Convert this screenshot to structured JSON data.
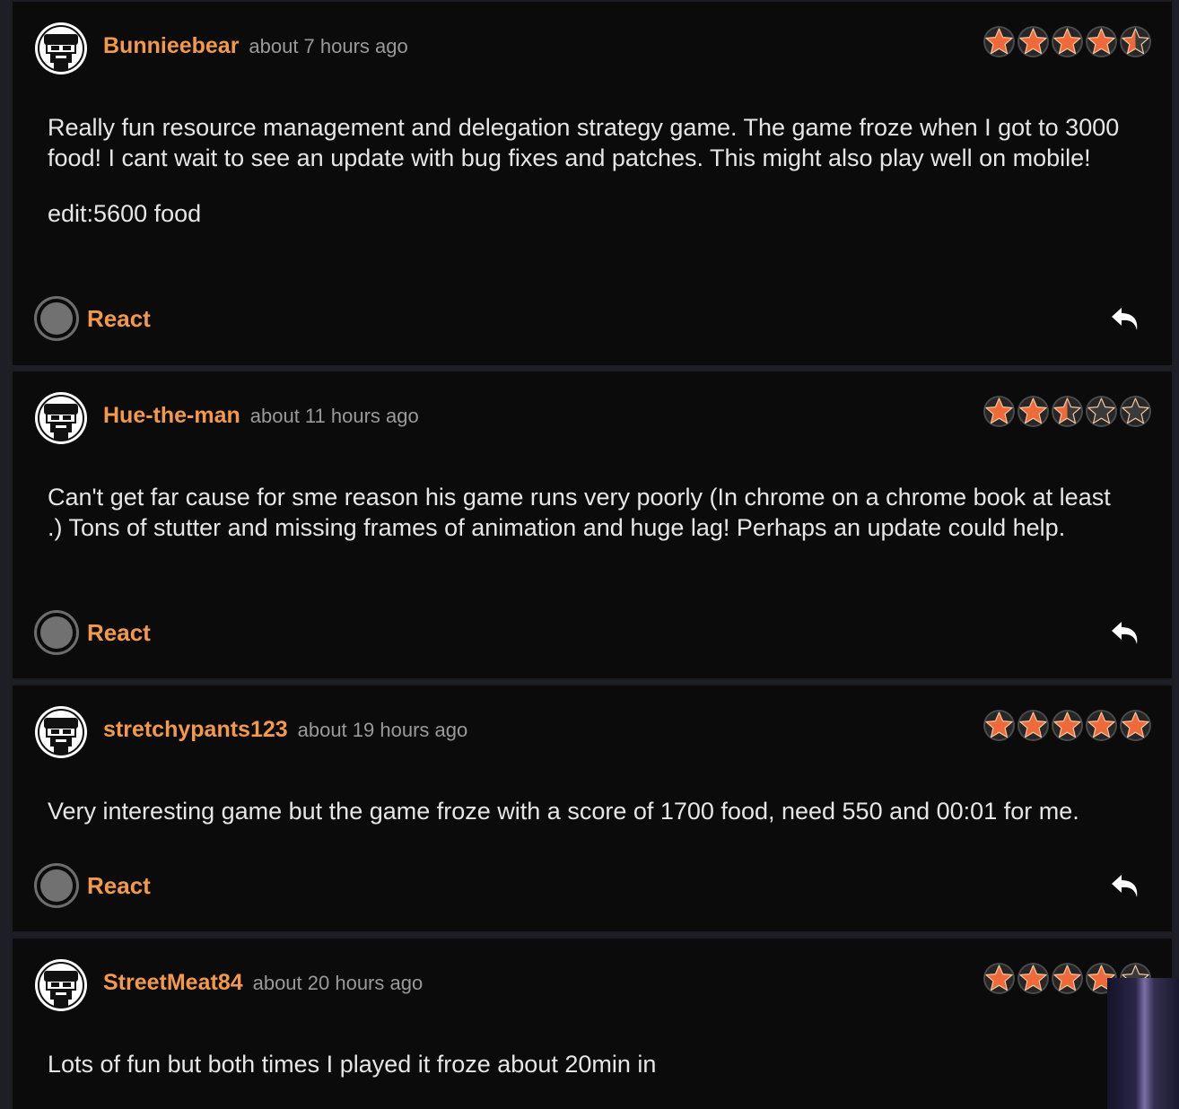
{
  "colors": {
    "accent": "#f3994a",
    "star_fill": "#ef6a3a",
    "star_empty": "#3a3a3a",
    "card_bg": "#0b0b0c",
    "text": "#e6e6e6",
    "muted": "#9a9a9a"
  },
  "reviews": [
    {
      "username": "Bunnieebear",
      "timestamp": "about 7 hours ago",
      "rating": 4.5,
      "paragraphs": [
        "Really fun resource management and delegation strategy game. The game froze when I got to 3000 food! I cant wait to see an update with bug fixes and patches. This might also play well on mobile!",
        "edit:5600 food"
      ],
      "react_label": "React",
      "reply_icon": "reply-arrow-icon"
    },
    {
      "username": "Hue-the-man",
      "timestamp": "about 11 hours ago",
      "rating": 2.5,
      "paragraphs": [
        "Can't get far cause for sme reason his game runs very poorly (In chrome on a chrome book at least .) Tons of stutter and missing frames of animation and huge lag! Perhaps an update could help."
      ],
      "react_label": "React",
      "reply_icon": "reply-arrow-icon"
    },
    {
      "username": "stretchypants123",
      "timestamp": "about 19 hours ago",
      "rating": 5,
      "paragraphs": [
        "Very interesting game but the game froze with a score of 1700 food, need 550 and 00:01 for me."
      ],
      "react_label": "React",
      "reply_icon": "reply-arrow-icon"
    },
    {
      "username": "StreetMeat84",
      "timestamp": "about 20 hours ago",
      "rating": 4,
      "paragraphs": [
        "Lots of fun but both times I played it froze about 20min in"
      ],
      "react_label": "React",
      "reply_icon": "reply-arrow-icon"
    }
  ]
}
